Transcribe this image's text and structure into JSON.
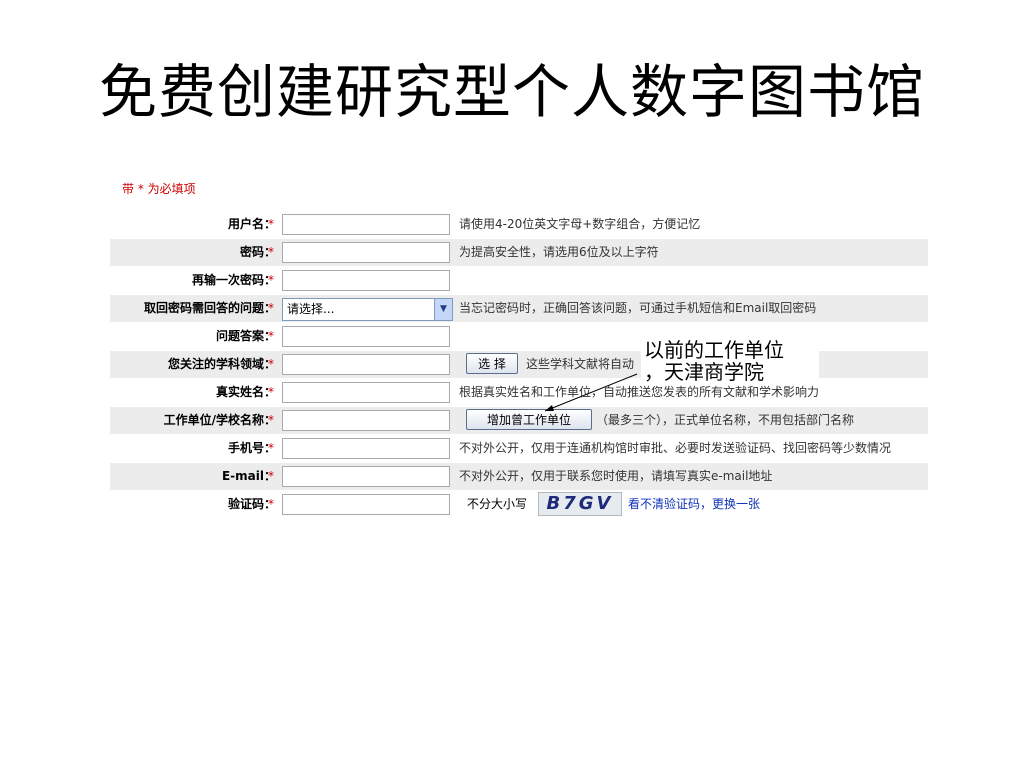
{
  "slide": {
    "title": "免费创建研究型个人数字图书馆"
  },
  "form": {
    "required_note": "带 * 为必填项",
    "star": "*",
    "rows": [
      {
        "label": "用户名：",
        "hint": "请使用4-20位英文字母+数字组合，方便记忆"
      },
      {
        "label": "密码：",
        "hint": "为提高安全性，请选用6位及以上字符"
      },
      {
        "label": "再输一次密码：",
        "hint": ""
      },
      {
        "label": "取回密码需回答的问题：",
        "select_value": "请选择...",
        "hint": "当忘记密码时，正确回答该问题，可通过手机短信和Email取回密码"
      },
      {
        "label": "问题答案：",
        "hint": ""
      },
      {
        "label": "您关注的学科领域：",
        "button": "选 择",
        "hint": "这些学科文献将自动"
      },
      {
        "label": "真实姓名：",
        "hint": "根据真实姓名和工作单位，自动推送您发表的所有文献和学术影响力"
      },
      {
        "label": "工作单位/学校名称：",
        "button": "增加曾工作单位",
        "hint": "（最多三个），正式单位名称，不用包括部门名称"
      },
      {
        "label": "手机号：",
        "hint": "不对外公开，仅用于连通机构馆时审批、必要时发送验证码、找回密码等少数情况"
      },
      {
        "label": "E-mail：",
        "hint": "不对外公开，仅用于联系您时使用，请填写真实e-mail地址"
      },
      {
        "label": "验证码：",
        "captcha_lead": "不分大小写",
        "captcha_text": "B7GV",
        "refresh_link": "看不清验证码，更换一张"
      }
    ]
  },
  "callout": {
    "lines": [
      "以前的工作单位",
      "，天津商学院"
    ]
  },
  "colors": {
    "required": "#d00000",
    "link": "#1034b8",
    "alt_row": "#ececec"
  }
}
